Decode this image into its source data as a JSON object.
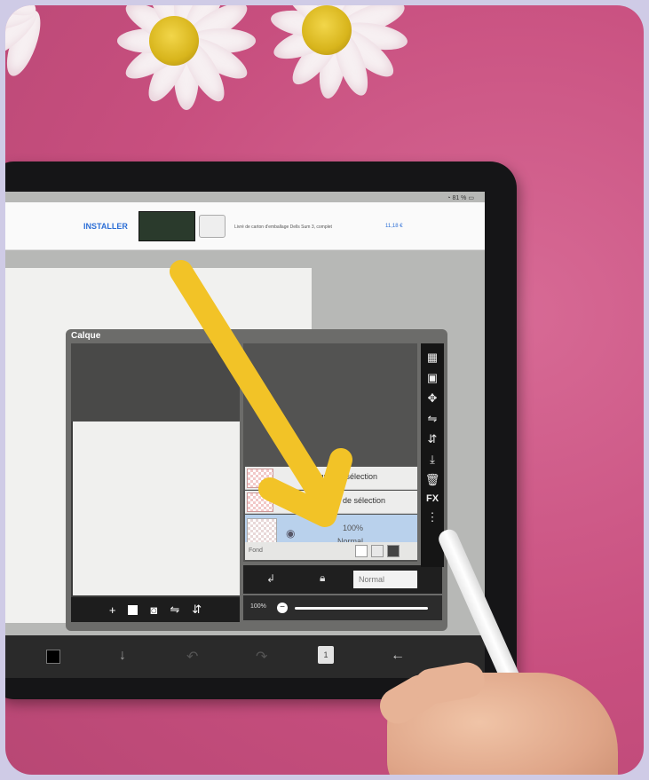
{
  "statusbar": {
    "battery": "81 %"
  },
  "ad": {
    "install_label": "INSTALLER",
    "description": "Livré de carton d'emballage Dells Sum 3, complet",
    "price": "11,18 €"
  },
  "dialog": {
    "title": "Calque",
    "preview_tools": [
      "+",
      "▪",
      "camera",
      "flip-h",
      "flip-v"
    ]
  },
  "layers": [
    {
      "label": "Calque de sélection"
    },
    {
      "label": "de sélection"
    }
  ],
  "selected_layer": {
    "opacity": "100%",
    "blend_mode": "Normal"
  },
  "fond": {
    "label": "Fond"
  },
  "blend_bar": {
    "mode": "Normal"
  },
  "opacity_bar": {
    "value_label": "100%",
    "value": 1.0
  },
  "side_tools": [
    "checker",
    "select-layer",
    "move",
    "flip-h",
    "flip-v",
    "merge-down",
    "delete",
    "FX",
    "more"
  ],
  "side_fx_label": "FX",
  "bottom_toolbar": {
    "layers_count": "1"
  },
  "colors": {
    "background": "#cfcbe6",
    "pink": "#c84f7f",
    "arrow": "#f2c327",
    "selected_layer": "#b9d1ec"
  }
}
